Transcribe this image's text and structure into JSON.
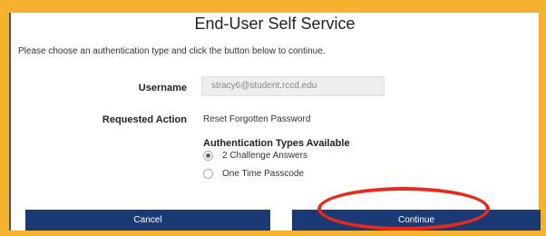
{
  "page": {
    "title": "End-User Self Service",
    "instructions": "Please choose an authentication type and click the button below to continue."
  },
  "form": {
    "username_label": "Username",
    "username_value": "stracy6@student.rccd.edu",
    "action_label": "Requested Action",
    "action_value": "Reset Forgotten Password",
    "auth_heading": "Authentication Types Available",
    "auth_options": [
      {
        "label": "2 Challenge Answers",
        "selected": true
      },
      {
        "label": "One Time Passcode",
        "selected": false
      }
    ]
  },
  "buttons": {
    "cancel": "Cancel",
    "continue": "Continue"
  },
  "colors": {
    "banner": "#f6b12e",
    "button": "#1b3a75",
    "highlight": "#e8291c"
  }
}
